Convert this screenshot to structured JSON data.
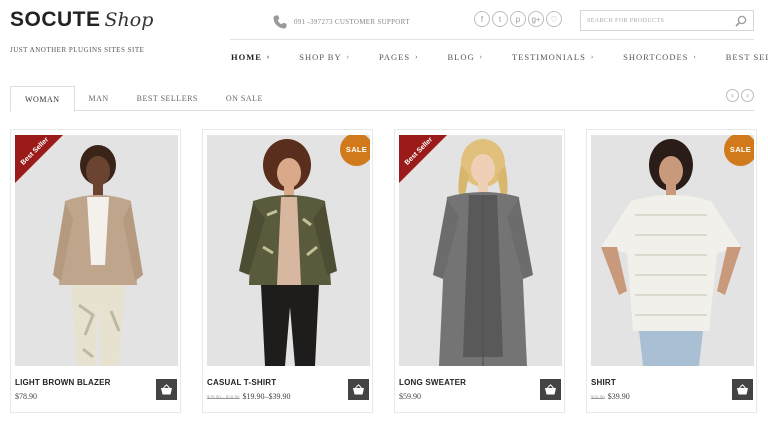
{
  "site": {
    "logo_main": "SOCUTE",
    "logo_script": "Shop",
    "tagline": "JUST ANOTHER PLUGINS SITES SITE"
  },
  "support": {
    "text": "091 -397273 CUSTOMER SUPPORT"
  },
  "social": [
    "f",
    "t",
    "p",
    "g+",
    "♡"
  ],
  "search": {
    "placeholder": "SEARCH FOR PRODUCTS"
  },
  "nav": [
    {
      "label": "HOME",
      "active": true
    },
    {
      "label": "SHOP BY"
    },
    {
      "label": "PAGES"
    },
    {
      "label": "BLOG"
    },
    {
      "label": "TESTIMONIALS"
    },
    {
      "label": "SHORTCODES"
    },
    {
      "label": "BEST SELLERS"
    }
  ],
  "tabs": [
    {
      "label": "WOMAN",
      "active": true
    },
    {
      "label": "MAN"
    },
    {
      "label": "BEST SELLERS"
    },
    {
      "label": "ON SALE"
    }
  ],
  "products": [
    {
      "name": "LIGHT BROWN BLAZER",
      "price": "$78.90",
      "old_price": "",
      "badge": "Best Seller",
      "sale": ""
    },
    {
      "name": "CASUAL T-SHIRT",
      "price": "$19.90–$39.90",
      "old_price": "$29.90 – $50.90",
      "badge": "",
      "sale": "SALE"
    },
    {
      "name": "LONG SWEATER",
      "price": "$59.90",
      "old_price": "",
      "badge": "Best Seller",
      "sale": ""
    },
    {
      "name": "SHIRT",
      "price": "$39.90",
      "old_price": "$50.90",
      "badge": "",
      "sale": "SALE"
    }
  ],
  "colors": {
    "ribbon": "#9b1b1b",
    "sale": "#d07a1c",
    "cart": "#444444"
  }
}
